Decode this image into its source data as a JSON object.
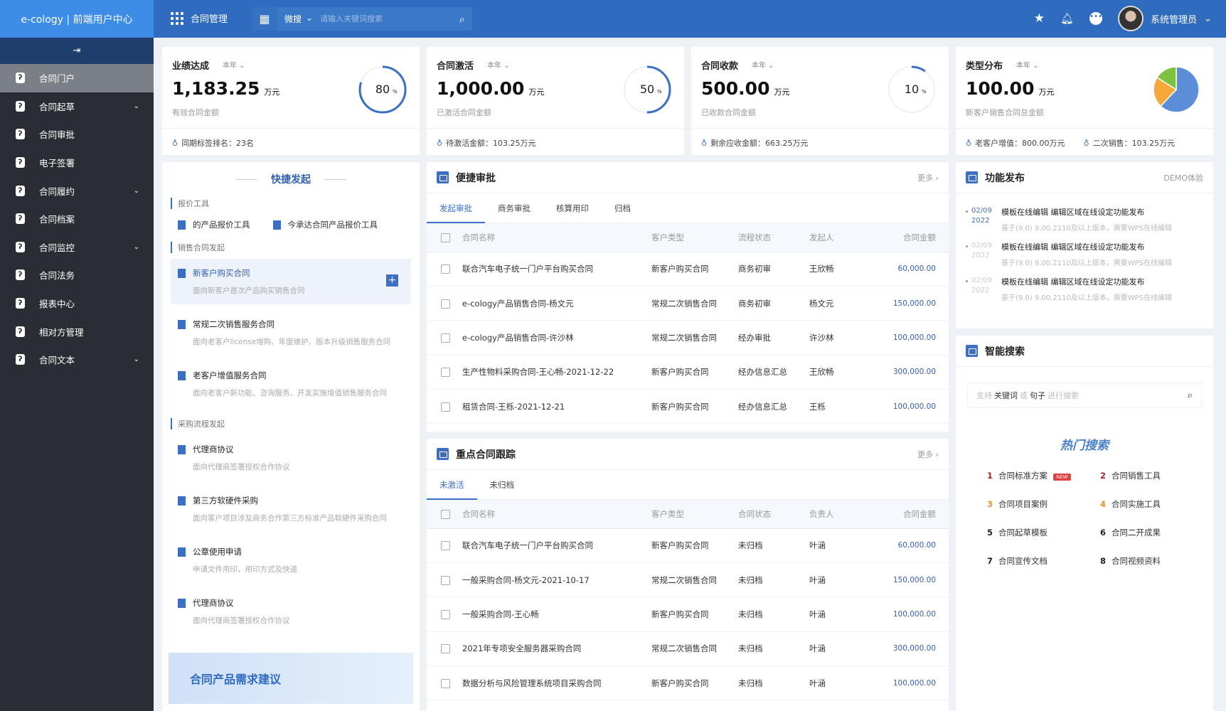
{
  "header": {
    "logo": "e-cology | 前端用户中心",
    "app_name": "合同管理",
    "search_scope": "微搜",
    "search_placeholder": "请输入关键词搜索",
    "user_name": "系统管理员",
    "colors": {
      "topbar": "#2f6cbf",
      "logo_bg": "#3d8ce6"
    }
  },
  "sidebar": {
    "collapse_icon": "collapse-icon",
    "items": [
      {
        "label": "合同门户",
        "active": true,
        "expandable": false
      },
      {
        "label": "合同起草",
        "expandable": true
      },
      {
        "label": "合同审批",
        "expandable": false
      },
      {
        "label": "电子签署",
        "expandable": false
      },
      {
        "label": "合同履约",
        "expandable": true
      },
      {
        "label": "合同档案",
        "expandable": false
      },
      {
        "label": "合同监控",
        "expandable": true
      },
      {
        "label": "合同法务",
        "expandable": false
      },
      {
        "label": "报表中心",
        "expandable": false
      },
      {
        "label": "相对方管理",
        "expandable": false
      },
      {
        "label": "合同文本",
        "expandable": true
      }
    ]
  },
  "stats": [
    {
      "title": "业绩达成",
      "period": "本年",
      "value": "1,183.25",
      "unit": "万元",
      "sub": "有效合同金额",
      "percent": 80,
      "percent_label": "80",
      "foot": [
        "同期标签排名：23名"
      ]
    },
    {
      "title": "合同激活",
      "period": "本年",
      "value": "1,000.00",
      "unit": "万元",
      "sub": "已激活合同金额",
      "percent": 50,
      "percent_label": "50",
      "foot": [
        "待激活金额：103.25万元"
      ]
    },
    {
      "title": "合同收款",
      "period": "本年",
      "value": "500.00",
      "unit": "万元",
      "sub": "已收款合同金额",
      "percent": 10,
      "percent_label": "10",
      "foot": [
        "剩余应收金额：663.25万元"
      ]
    },
    {
      "title": "类型分布",
      "period": "本年",
      "value": "100.00",
      "unit": "万元",
      "sub": "新客户销售合同总金额",
      "pie": [
        {
          "fraction": 0.62,
          "color": "#5b8dd9"
        },
        {
          "fraction": 0.22,
          "color": "#f5a93a"
        },
        {
          "fraction": 0.16,
          "color": "#7dc141"
        }
      ],
      "foot": [
        "老客户增值：800.00万元",
        "二次销售：103.25万元"
      ]
    }
  ],
  "quick": {
    "title": "快捷发起",
    "sections": [
      {
        "label": "报价工具",
        "tools": [
          "的产品报价工具",
          "今承达合同产品报价工具"
        ]
      },
      {
        "label": "销售合同发起",
        "items": [
          {
            "name": "新客户购买合同",
            "desc": "面向新客户首次产品购买销售合同",
            "highlight": true
          },
          {
            "name": "常规二次销售服务合同",
            "desc": "面向老客户license增购、年度维护、版本升级销售服务合同"
          },
          {
            "name": "老客户增值服务合同",
            "desc": "面向老客户新功能、咨询服务、开发实施增值销售服务合同"
          }
        ]
      },
      {
        "label": "采购流程发起",
        "items": [
          {
            "name": "代理商协议",
            "desc": "面向代理商签署授权合作协议"
          },
          {
            "name": "第三方软硬件采购",
            "desc": "面向客户项目涉及商务合作第三方标准产品软硬件采购合同"
          },
          {
            "name": "公章使用申请",
            "desc": "申请文件用印，用印方式及快递"
          },
          {
            "name": "代理商协议",
            "desc": "面向代理商签署授权合作协议"
          }
        ]
      }
    ],
    "banner": "合同产品需求建议"
  },
  "approval": {
    "title": "便捷审批",
    "more": "更多 ›",
    "tabs": [
      "发起审批",
      "商务审批",
      "核算用印",
      "归档"
    ],
    "active_tab": 0,
    "columns": [
      "合同名称",
      "客户类型",
      "流程状态",
      "发起人",
      "合同金额"
    ],
    "rows": [
      [
        "联合汽车电子统一门户平台购买合同",
        "新客户购买合同",
        "商务初审",
        "王欣畅",
        "60,000.00"
      ],
      [
        "e-cology产品销售合同-杨文元",
        "常规二次销售合同",
        "商务初审",
        "杨文元",
        "150,000.00"
      ],
      [
        "e-cology产品销售合同-许沙林",
        "常规二次销售合同",
        "经办审批",
        "许沙林",
        "100,000.00"
      ],
      [
        "生产性物料采购合同-王心畅-2021-12-22",
        "新客户购买合同",
        "经办信息汇总",
        "王欣畅",
        "300,000.00"
      ],
      [
        "租赁合同-王栎-2021-12-21",
        "新客户购买合同",
        "经办信息汇总",
        "王栎",
        "100,000.00"
      ]
    ]
  },
  "tracking": {
    "title": "重点合同跟踪",
    "more": "更多 ›",
    "tabs": [
      "未激活",
      "未归档"
    ],
    "active_tab": 0,
    "columns": [
      "合同名称",
      "客户类型",
      "合同状态",
      "负责人",
      "合同金额"
    ],
    "rows": [
      [
        "联合汽车电子统一门户平台购买合同",
        "新客户购买合同",
        "未归档",
        "叶涵",
        "60,000.00"
      ],
      [
        "一般采购合同-杨文元-2021-10-17",
        "常规二次销售合同",
        "未归档",
        "叶涵",
        "150,000.00"
      ],
      [
        "一般采购合同-王心畅",
        "新客户购买合同",
        "未归档",
        "叶涵",
        "100,000.00"
      ],
      [
        "2021年专项安全服务器采购合同",
        "常规二次销售合同",
        "未归档",
        "叶涵",
        "300,000.00"
      ],
      [
        "数据分析与风险管理系统项目采购合同",
        "新客户购买合同",
        "未归档",
        "叶涵",
        "100,000.00"
      ]
    ]
  },
  "release": {
    "title": "功能发布",
    "demo": "DEMO体验",
    "items": [
      {
        "date": "02/09",
        "year": "2022",
        "title": "模板在线编辑 编辑区域在线设定功能发布",
        "desc": "基于(9.0) 9.00.2110及以上版本，需要WPS在线编辑"
      },
      {
        "date": "02/09",
        "year": "2022",
        "title": "模板在线编辑 编辑区域在线设定功能发布",
        "desc": "基于(9.0) 9.00.2110及以上版本，需要WPS在线编辑"
      },
      {
        "date": "02/09",
        "year": "2022",
        "title": "模板在线编辑 编辑区域在线设定功能发布",
        "desc": "基于(9.0) 9.00.2110及以上版本，需要WPS在线编辑"
      }
    ]
  },
  "smart_search": {
    "title": "智能搜索",
    "placeholder_pre": "支持",
    "kw1": "关键词",
    "mid": "或",
    "kw2": "句子",
    "placeholder_post": "进行搜索",
    "hot_title": "热门搜索",
    "new_badge": "NEW",
    "hot": [
      {
        "rank": "1",
        "label": "合同标准方案",
        "color": "#b0202a",
        "new": true
      },
      {
        "rank": "2",
        "label": "合同销售工具",
        "color": "#b0202a"
      },
      {
        "rank": "3",
        "label": "合同项目案例",
        "color": "#e0962a"
      },
      {
        "rank": "4",
        "label": "合同实施工具",
        "color": "#e0962a"
      },
      {
        "rank": "5",
        "label": "合同起草模板",
        "color": "#222"
      },
      {
        "rank": "6",
        "label": "合同二开成果",
        "color": "#222"
      },
      {
        "rank": "7",
        "label": "合同宣传文档",
        "color": "#222"
      },
      {
        "rank": "8",
        "label": "合同视频资料",
        "color": "#222"
      }
    ]
  }
}
